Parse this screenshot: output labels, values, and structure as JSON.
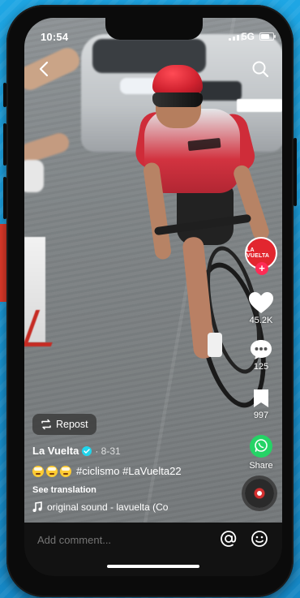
{
  "status_bar": {
    "time": "10:54",
    "network": "5G"
  },
  "nav": {
    "back_icon": "chevron-left-icon",
    "search_icon": "search-icon"
  },
  "creator": {
    "avatar_text": "LA VUELTA",
    "name": "La Vuelta",
    "verified": true,
    "date": "· 8-31"
  },
  "actions": {
    "likes": "45.2K",
    "comments": "125",
    "saves": "997",
    "share_label": "Share"
  },
  "post": {
    "repost_label": "Repost",
    "caption": "#ciclismo #LaVuelta22",
    "emoji_count": 3,
    "see_translation": "See translation",
    "sound": "original sound - lavuelta (Co"
  },
  "comment_bar": {
    "placeholder": "Add comment..."
  },
  "colors": {
    "brand_red": "#e2262f",
    "follow_pink": "#fe2c55",
    "whatsapp_green": "#25d366",
    "verified_blue": "#20d5ec",
    "background_blue": "#1b9ad6"
  }
}
